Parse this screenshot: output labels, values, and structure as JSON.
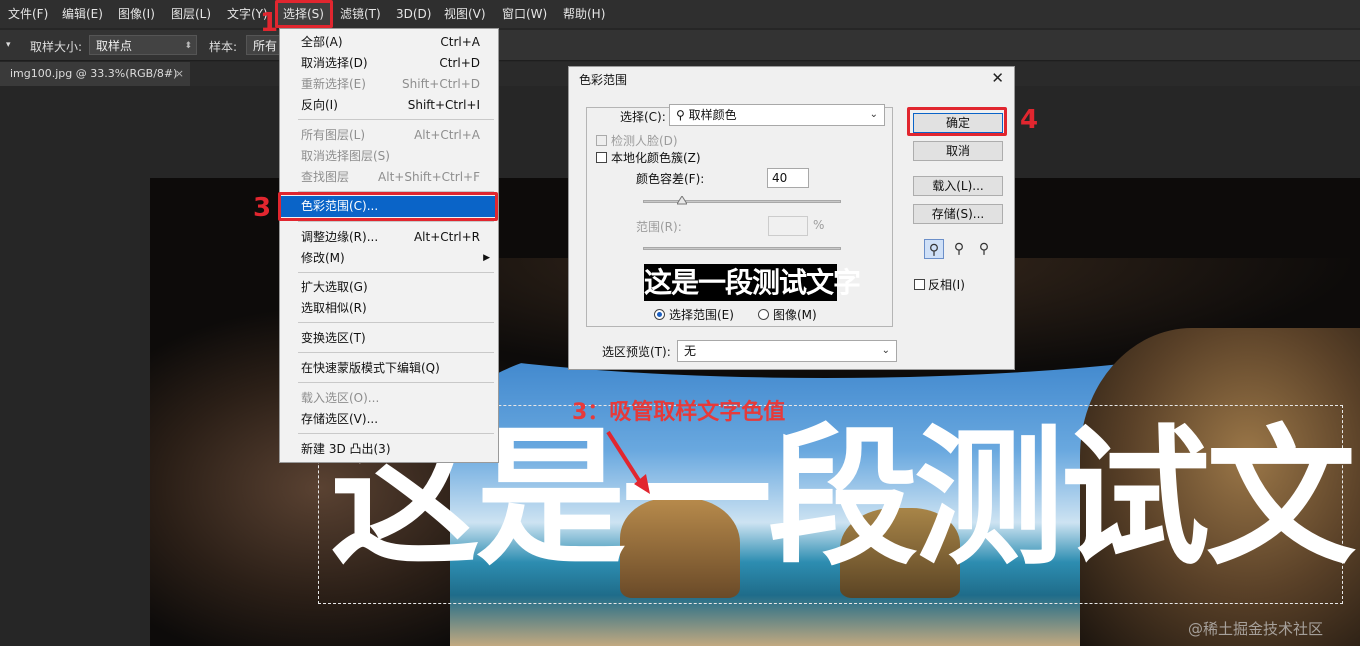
{
  "menubar": {
    "items": [
      "文件(F)",
      "编辑(E)",
      "图像(I)",
      "图层(L)",
      "文字(Y)",
      "选择(S)",
      "滤镜(T)",
      "3D(D)",
      "视图(V)",
      "窗口(W)",
      "帮助(H)"
    ]
  },
  "options_bar": {
    "sample_size_label": "取样大小:",
    "sample_size_value": "取样点",
    "sample_label": "样本:",
    "sample_value": "所有图"
  },
  "tab": {
    "title": "img100.jpg @ 33.3%(RGB/8#)",
    "close": "×"
  },
  "select_menu": {
    "items": [
      {
        "label": "全部(A)",
        "shortcut": "Ctrl+A",
        "disabled": false
      },
      {
        "label": "取消选择(D)",
        "shortcut": "Ctrl+D",
        "disabled": false
      },
      {
        "label": "重新选择(E)",
        "shortcut": "Shift+Ctrl+D",
        "disabled": true
      },
      {
        "label": "反向(I)",
        "shortcut": "Shift+Ctrl+I",
        "disabled": false
      },
      {
        "label": "所有图层(L)",
        "shortcut": "Alt+Ctrl+A",
        "disabled": true
      },
      {
        "label": "取消选择图层(S)",
        "shortcut": "",
        "disabled": true
      },
      {
        "label": "查找图层",
        "shortcut": "Alt+Shift+Ctrl+F",
        "disabled": true
      },
      {
        "label": "色彩范围(C)...",
        "shortcut": "",
        "disabled": false,
        "highlighted": true
      },
      {
        "label": "调整边缘(R)...",
        "shortcut": "Alt+Ctrl+R",
        "disabled": false
      },
      {
        "label": "修改(M)",
        "shortcut": "",
        "disabled": false,
        "submenu": true
      },
      {
        "label": "扩大选取(G)",
        "shortcut": "",
        "disabled": false
      },
      {
        "label": "选取相似(R)",
        "shortcut": "",
        "disabled": false
      },
      {
        "label": "变换选区(T)",
        "shortcut": "",
        "disabled": false
      },
      {
        "label": "在快速蒙版模式下编辑(Q)",
        "shortcut": "",
        "disabled": false
      },
      {
        "label": "载入选区(O)...",
        "shortcut": "",
        "disabled": true
      },
      {
        "label": "存储选区(V)...",
        "shortcut": "",
        "disabled": false
      },
      {
        "label": "新建 3D 凸出(3)",
        "shortcut": "",
        "disabled": false
      }
    ]
  },
  "dialog": {
    "title": "色彩范围",
    "close": "✕",
    "select_label": "选择(C):",
    "select_value": "取样颜色",
    "detect_faces": "检测人脸(D)",
    "localized_clusters": "本地化颜色簇(Z)",
    "fuzziness_label": "颜色容差(F):",
    "fuzziness_value": "40",
    "range_label": "范围(R):",
    "range_unit": "%",
    "preview_text": "这是一段测试文字",
    "radio_selection": "选择范围(E)",
    "radio_image": "图像(M)",
    "selection_preview_label": "选区预览(T):",
    "selection_preview_value": "无",
    "ok": "确定",
    "cancel": "取消",
    "load": "载入(L)...",
    "save": "存储(S)...",
    "invert": "反相(I)"
  },
  "canvas": {
    "text": "这是一段测试文字",
    "annotation": "3：吸管取样文字色值"
  },
  "steps": {
    "s1": "1",
    "s3": "3",
    "s4": "4"
  },
  "watermark": "@稀土掘金技术社区"
}
